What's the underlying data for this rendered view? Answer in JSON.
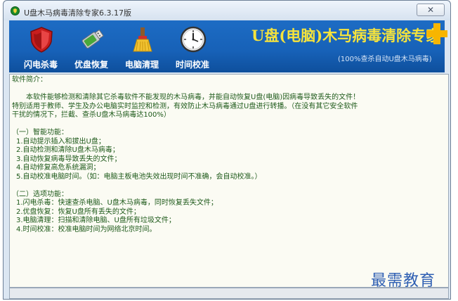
{
  "window": {
    "title": "U盘木马病毒清除专家6.3.17版",
    "close_glyph": "✕"
  },
  "toolbar": {
    "buttons": [
      {
        "label": "闪电杀毒",
        "icon": "shield-icon"
      },
      {
        "label": "优盘恢复",
        "icon": "usb-drive-icon"
      },
      {
        "label": "电脑清理",
        "icon": "broom-icon"
      },
      {
        "label": "时间校准",
        "icon": "clock-icon"
      }
    ],
    "brand_title": "U盘(电脑)木马病毒清除专家",
    "subtitle": "(100%查杀自动U盘木马病毒)",
    "brand_icon": "cross-icon"
  },
  "content": {
    "intro_heading": "软件简介：",
    "intro_lines": [
      "本软件能够检测和清除其它杀毒软件不能发现的木马病毒，并能自动恢复U盘(电脑)因病毒导致丢失的文件！",
      "特别适用于教师、学生及办公电脑实时监控和检测，有效防止木马病毒通过U盘进行转播。（在没有其它安全软件",
      "干扰的情况下，拦截、查杀U盘木马病毒达100%）"
    ],
    "section1_heading": "（一）智能功能：",
    "section1_items": [
      "1.自动提示插入和拔出U盘；",
      "2.自动检测和清除U盘木马病毒；",
      "3.自动恢复病毒导致丢失的文件；",
      "4.自动修复高危系统漏洞；",
      "5.自动校准电脑时间。（如：电脑主板电池失效出现时间不准确，会自动校准。）"
    ],
    "section2_heading": "（二）选项功能：",
    "section2_items": [
      "1.闪电杀毒：快速查杀电脑、U盘木马病毒，同时恢复丢失文件；",
      "2.优盘恢复：恢复U盘所有丢失的文件；",
      "3.电脑清理：扫描和清除电脑、U盘所有垃圾文件；",
      "4.时间校准：校准电脑时间为网络北京时间。"
    ]
  },
  "watermark": "最需教育",
  "colors": {
    "toolbar_blue": "#1761b7",
    "brand_yellow": "#f6e33c",
    "text_green": "#1e5a1a"
  }
}
